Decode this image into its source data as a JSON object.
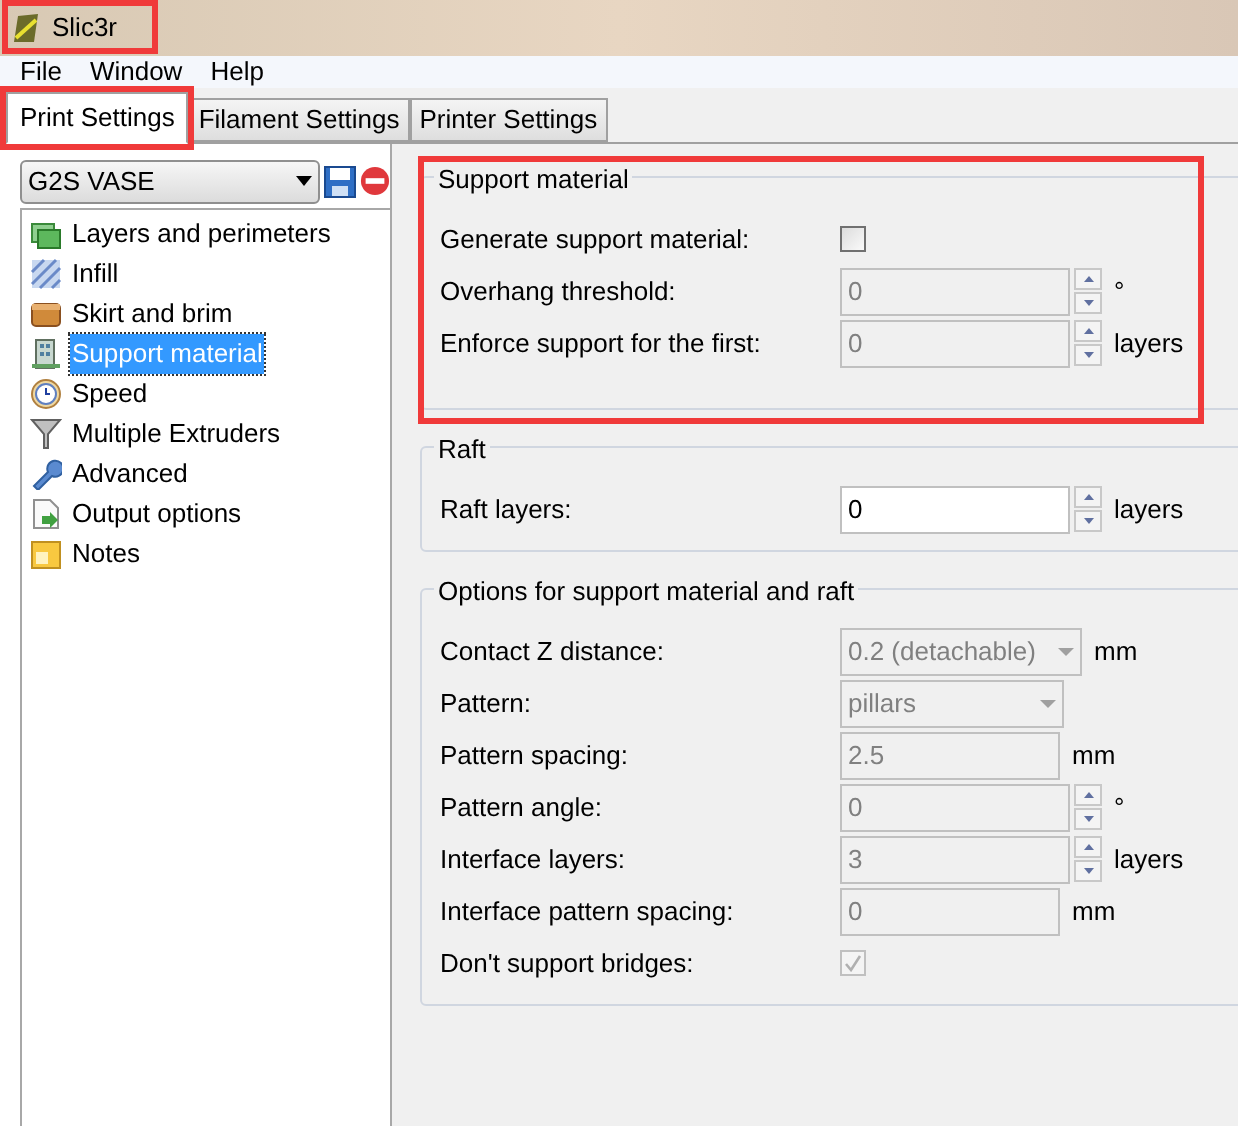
{
  "window": {
    "title": "Slic3r",
    "highlighted": true
  },
  "menu": [
    "File",
    "Window",
    "Help"
  ],
  "tabs": [
    {
      "label": "Print Settings",
      "selected": true,
      "highlighted": true
    },
    {
      "label": "Filament Settings",
      "selected": false,
      "highlighted": false
    },
    {
      "label": "Printer Settings",
      "selected": false,
      "highlighted": false
    }
  ],
  "preset": {
    "value": "G2S VASE"
  },
  "sidebar": {
    "items": [
      {
        "label": "Layers and perimeters",
        "selected": false
      },
      {
        "label": "Infill",
        "selected": false
      },
      {
        "label": "Skirt and brim",
        "selected": false
      },
      {
        "label": "Support material",
        "selected": true
      },
      {
        "label": "Speed",
        "selected": false
      },
      {
        "label": "Multiple Extruders",
        "selected": false
      },
      {
        "label": "Advanced",
        "selected": false
      },
      {
        "label": "Output options",
        "selected": false
      },
      {
        "label": "Notes",
        "selected": false
      }
    ]
  },
  "groups": [
    {
      "title": "Support material",
      "highlighted": true,
      "fields": [
        {
          "kind": "checkbox",
          "label": "Generate support material:",
          "checked": false,
          "disabled": false
        },
        {
          "kind": "spin",
          "label": "Overhang threshold:",
          "value": "0",
          "unit": "°",
          "disabled": true
        },
        {
          "kind": "spin",
          "label": "Enforce support for the first:",
          "value": "0",
          "unit": "layers",
          "disabled": true
        }
      ]
    },
    {
      "title": "Raft",
      "highlighted": false,
      "fields": [
        {
          "kind": "spin",
          "label": "Raft layers:",
          "value": "0",
          "unit": "layers",
          "disabled": false
        }
      ]
    },
    {
      "title": "Options for support material and raft",
      "highlighted": false,
      "fields": [
        {
          "kind": "combo",
          "label": "Contact Z distance:",
          "value": "0.2 (detachable)",
          "unit": "mm",
          "disabled": true
        },
        {
          "kind": "select",
          "label": "Pattern:",
          "value": "pillars",
          "disabled": true
        },
        {
          "kind": "text",
          "label": "Pattern spacing:",
          "value": "2.5",
          "unit": "mm",
          "disabled": true
        },
        {
          "kind": "spin",
          "label": "Pattern angle:",
          "value": "0",
          "unit": "°",
          "disabled": true
        },
        {
          "kind": "spin",
          "label": "Interface layers:",
          "value": "3",
          "unit": "layers",
          "disabled": true
        },
        {
          "kind": "text",
          "label": "Interface pattern spacing:",
          "value": "0",
          "unit": "mm",
          "disabled": true
        },
        {
          "kind": "checkbox",
          "label": "Don't support bridges:",
          "checked": true,
          "disabled": true
        }
      ]
    }
  ]
}
